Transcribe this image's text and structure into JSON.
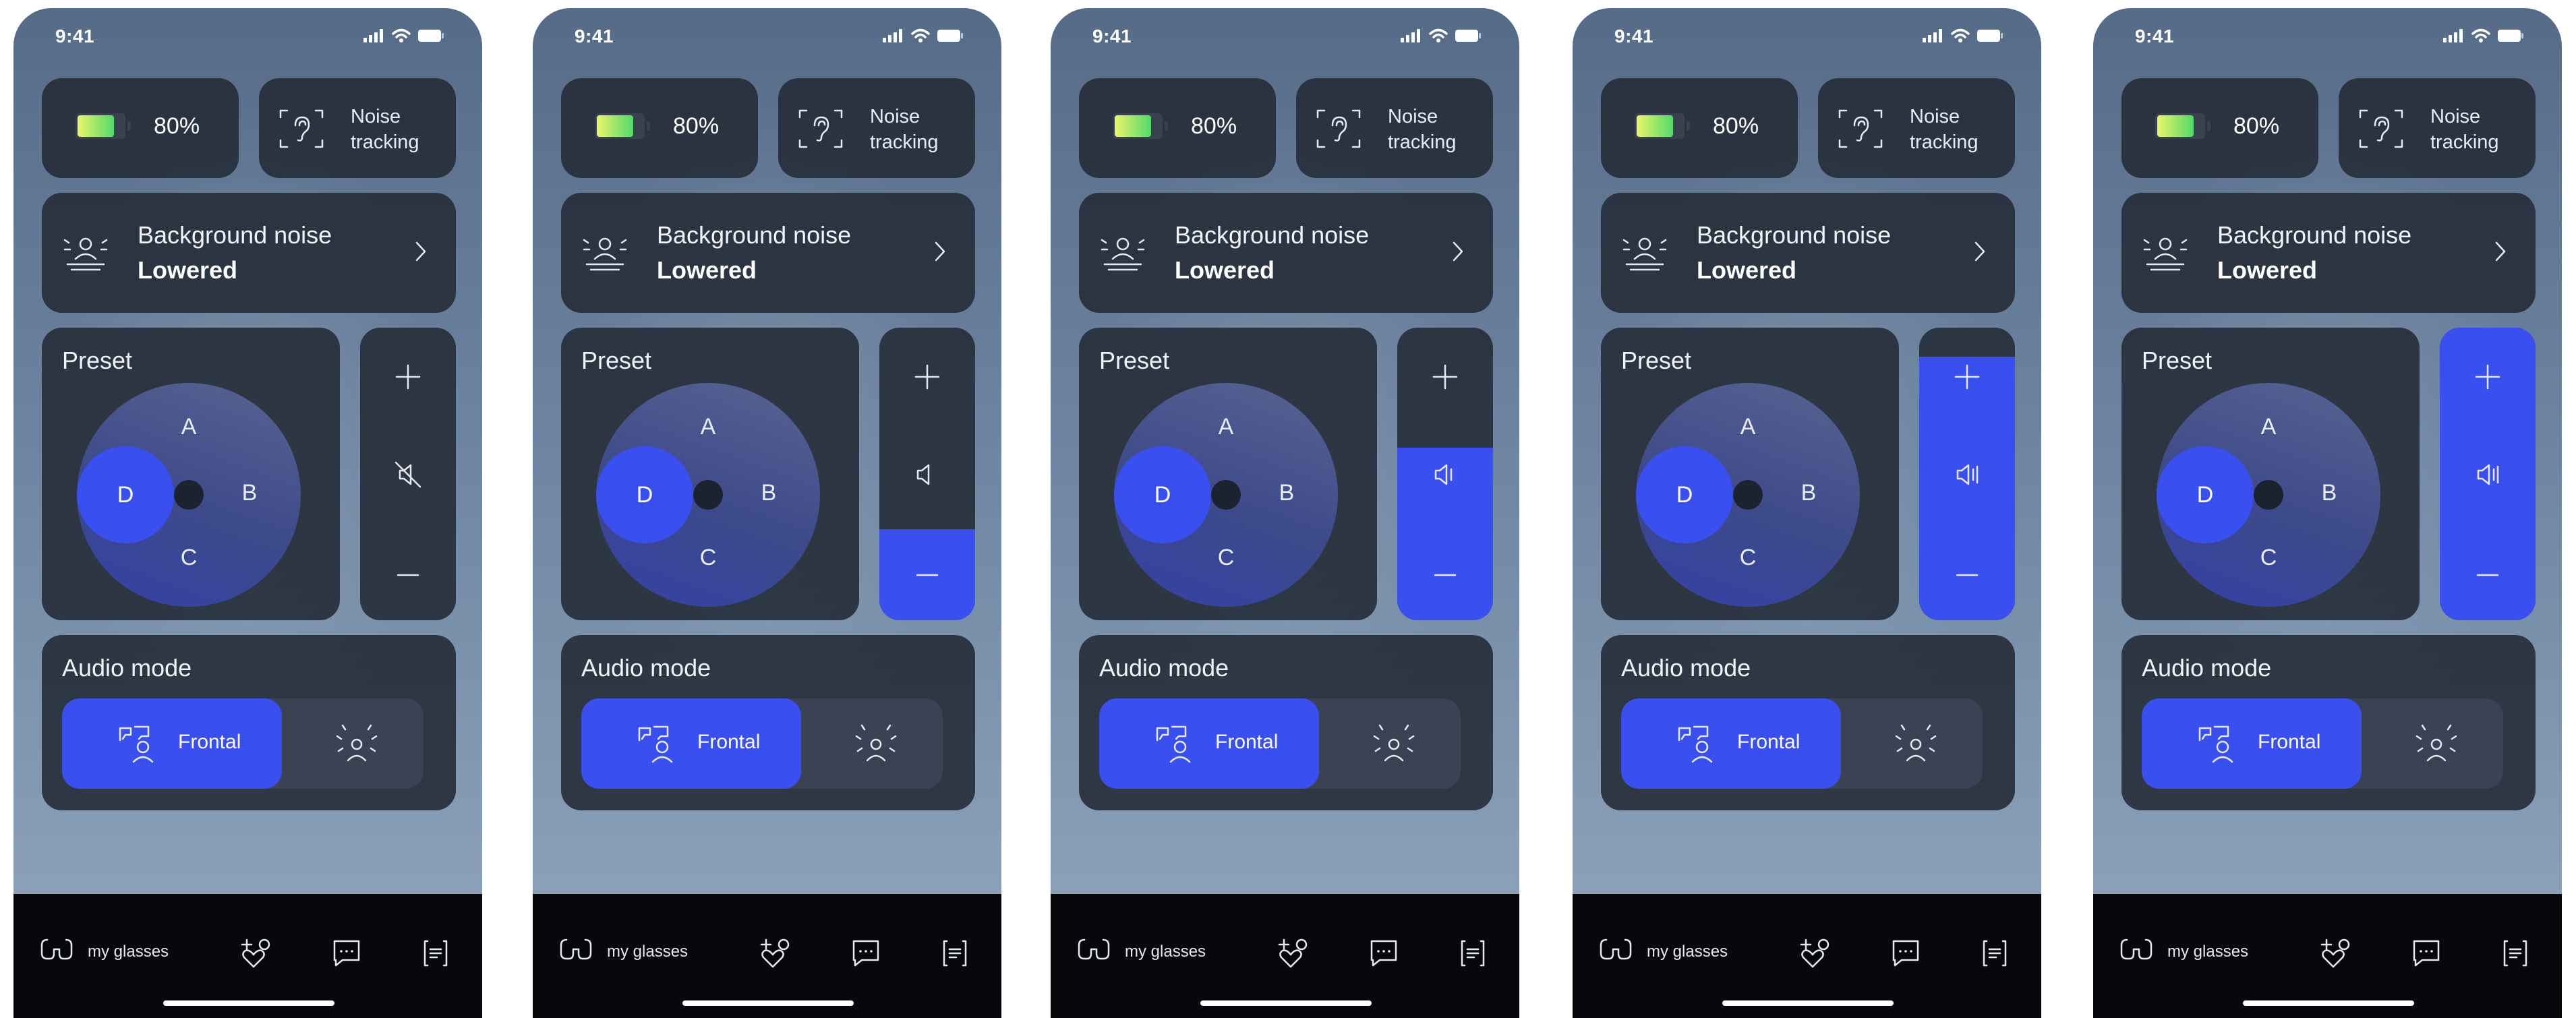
{
  "accent_color": "#3a4ff0",
  "screens": [
    {
      "status": {
        "time": "9:41",
        "icons": [
          "signal-icon",
          "wifi-icon",
          "battery-status-icon"
        ]
      },
      "battery": {
        "percent": "80%",
        "level": 0.8
      },
      "noise_tracking": {
        "line1": "Noise",
        "line2": "tracking"
      },
      "background_noise": {
        "title": "Background noise",
        "value": "Lowered"
      },
      "preset": {
        "title": "Preset",
        "letters": [
          "A",
          "B",
          "C",
          "D"
        ],
        "selected": "D"
      },
      "volume": {
        "level": 0.0,
        "muted": true
      },
      "audio_mode": {
        "title": "Audio mode",
        "selected_label": "Frontal"
      },
      "tabbar": {
        "active_label": "my glasses"
      }
    },
    {
      "status": {
        "time": "9:41",
        "icons": [
          "signal-icon",
          "wifi-icon",
          "battery-status-icon"
        ]
      },
      "battery": {
        "percent": "80%",
        "level": 0.8
      },
      "noise_tracking": {
        "line1": "Noise",
        "line2": "tracking"
      },
      "background_noise": {
        "title": "Background noise",
        "value": "Lowered"
      },
      "preset": {
        "title": "Preset",
        "letters": [
          "A",
          "B",
          "C",
          "D"
        ],
        "selected": "D"
      },
      "volume": {
        "level": 0.31,
        "muted": false
      },
      "audio_mode": {
        "title": "Audio mode",
        "selected_label": "Frontal"
      },
      "tabbar": {
        "active_label": "my glasses"
      }
    },
    {
      "status": {
        "time": "9:41",
        "icons": [
          "signal-icon",
          "wifi-icon",
          "battery-status-icon"
        ]
      },
      "battery": {
        "percent": "80%",
        "level": 0.8
      },
      "noise_tracking": {
        "line1": "Noise",
        "line2": "tracking"
      },
      "background_noise": {
        "title": "Background noise",
        "value": "Lowered"
      },
      "preset": {
        "title": "Preset",
        "letters": [
          "A",
          "B",
          "C",
          "D"
        ],
        "selected": "D"
      },
      "volume": {
        "level": 0.59,
        "muted": false
      },
      "audio_mode": {
        "title": "Audio mode",
        "selected_label": "Frontal"
      },
      "tabbar": {
        "active_label": "my glasses"
      }
    },
    {
      "status": {
        "time": "9:41",
        "icons": [
          "signal-icon",
          "wifi-icon",
          "battery-status-icon"
        ]
      },
      "battery": {
        "percent": "80%",
        "level": 0.8
      },
      "noise_tracking": {
        "line1": "Noise",
        "line2": "tracking"
      },
      "background_noise": {
        "title": "Background noise",
        "value": "Lowered"
      },
      "preset": {
        "title": "Preset",
        "letters": [
          "A",
          "B",
          "C",
          "D"
        ],
        "selected": "D"
      },
      "volume": {
        "level": 0.9,
        "muted": false
      },
      "audio_mode": {
        "title": "Audio mode",
        "selected_label": "Frontal"
      },
      "tabbar": {
        "active_label": "my glasses"
      }
    },
    {
      "status": {
        "time": "9:41",
        "icons": [
          "signal-icon",
          "wifi-icon",
          "battery-status-icon"
        ]
      },
      "battery": {
        "percent": "80%",
        "level": 0.8
      },
      "noise_tracking": {
        "line1": "Noise",
        "line2": "tracking"
      },
      "background_noise": {
        "title": "Background noise",
        "value": "Lowered"
      },
      "preset": {
        "title": "Preset",
        "letters": [
          "A",
          "B",
          "C",
          "D"
        ],
        "selected": "D"
      },
      "volume": {
        "level": 1.0,
        "muted": false
      },
      "audio_mode": {
        "title": "Audio mode",
        "selected_label": "Frontal"
      },
      "tabbar": {
        "active_label": "my glasses"
      }
    }
  ]
}
